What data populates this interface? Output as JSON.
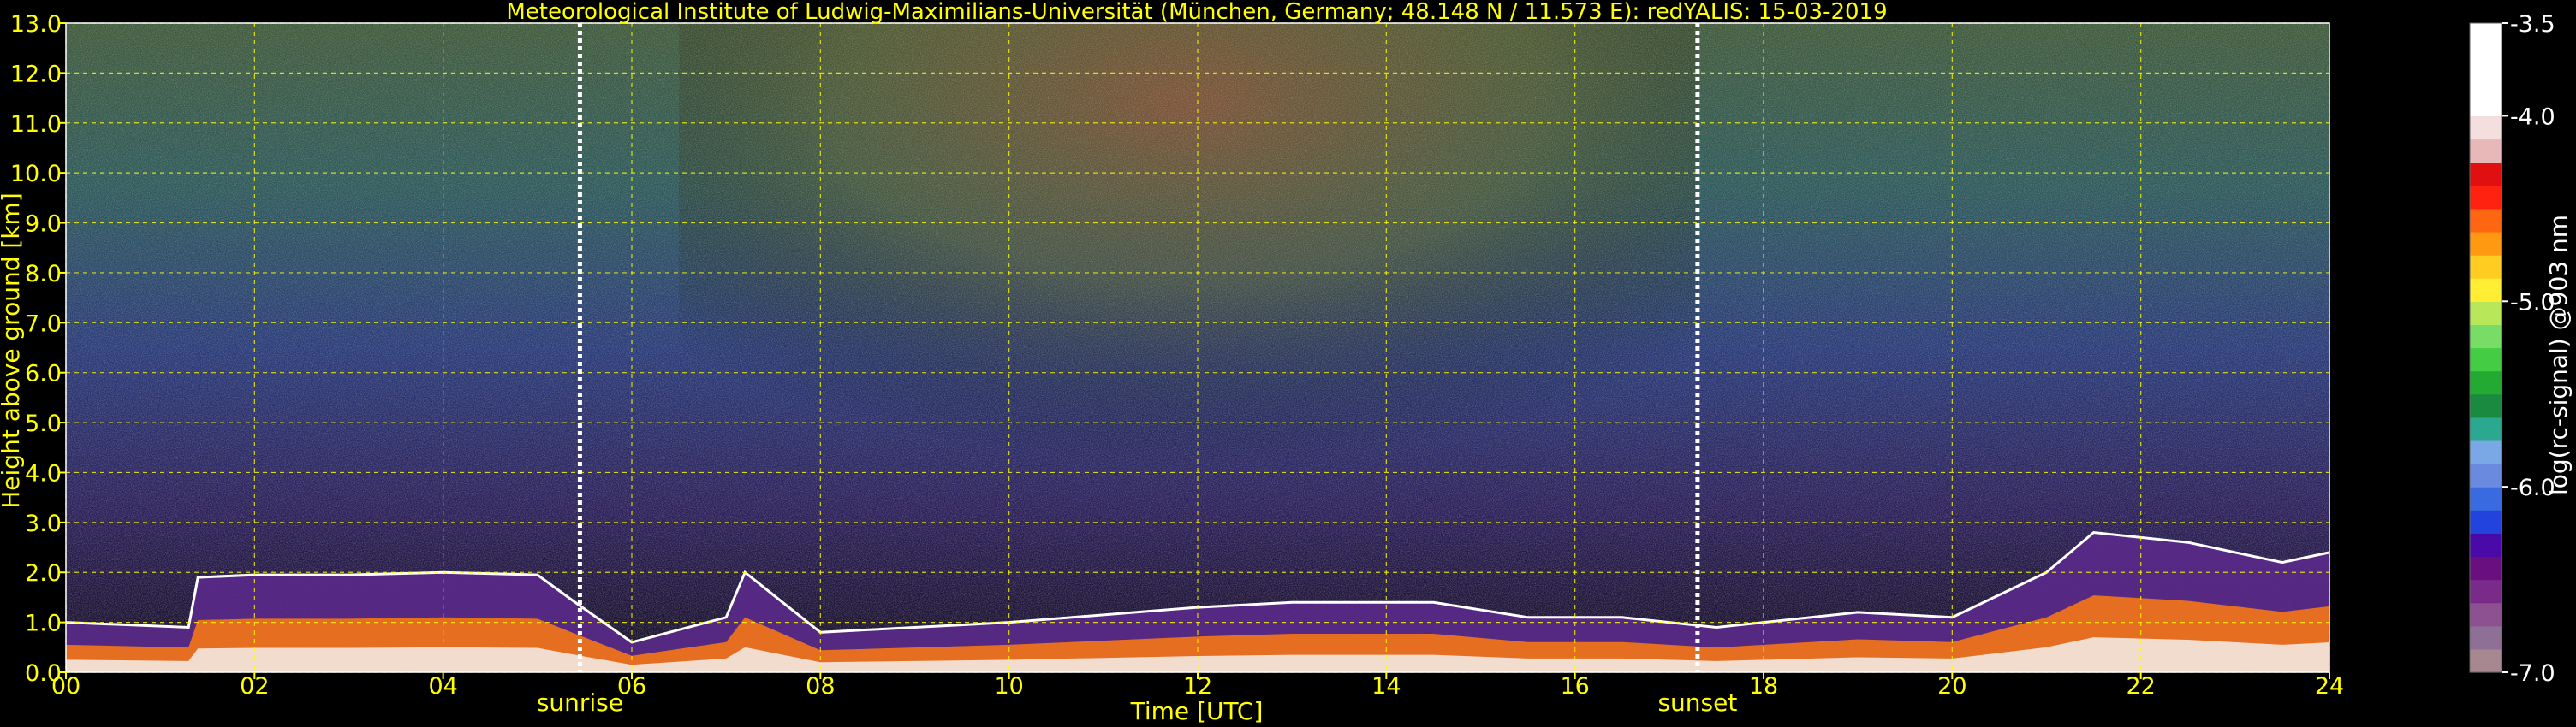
{
  "chart_data": {
    "type": "heatmap",
    "title": "Meteorological Institute of Ludwig-Maximilians-Universität (München, Germany; 48.148 N / 11.573 E):    redYALIS: 15-03-2019",
    "xlabel": "Time [UTC]",
    "ylabel": "Height above ground [km]",
    "xlim": [
      0,
      24
    ],
    "ylim": [
      0,
      13
    ],
    "x_ticks": [
      "00",
      "02",
      "04",
      "06",
      "08",
      "10",
      "12",
      "14",
      "16",
      "18",
      "20",
      "22",
      "24"
    ],
    "x_tick_values": [
      0,
      2,
      4,
      6,
      8,
      10,
      12,
      14,
      16,
      18,
      20,
      22,
      24
    ],
    "y_ticks": [
      "0.0",
      "1.0",
      "2.0",
      "3.0",
      "4.0",
      "5.0",
      "6.0",
      "7.0",
      "8.0",
      "9.0",
      "10.0",
      "11.0",
      "12.0",
      "13.0"
    ],
    "y_tick_values": [
      0,
      1,
      2,
      3,
      4,
      5,
      6,
      7,
      8,
      9,
      10,
      11,
      12,
      13
    ],
    "grid": true,
    "annotations": [
      {
        "label": "sunrise",
        "x": 5.45
      },
      {
        "label": "sunset",
        "x": 17.3
      }
    ],
    "boundary_layer_top_km": [
      [
        0,
        1.0
      ],
      [
        1.3,
        0.9
      ],
      [
        1.4,
        1.9
      ],
      [
        2.0,
        1.95
      ],
      [
        3.0,
        1.95
      ],
      [
        4.0,
        2.0
      ],
      [
        5.0,
        1.95
      ],
      [
        5.4,
        1.4
      ],
      [
        6.0,
        0.6
      ],
      [
        7.0,
        1.1
      ],
      [
        7.2,
        2.0
      ],
      [
        8.0,
        0.8
      ],
      [
        10.0,
        1.0
      ],
      [
        12.0,
        1.3
      ],
      [
        13.0,
        1.4
      ],
      [
        14.5,
        1.4
      ],
      [
        15.5,
        1.1
      ],
      [
        16.5,
        1.1
      ],
      [
        17.5,
        0.9
      ],
      [
        19.0,
        1.2
      ],
      [
        20.0,
        1.1
      ],
      [
        21.0,
        2.0
      ],
      [
        21.5,
        2.8
      ],
      [
        22.5,
        2.6
      ],
      [
        23.5,
        2.2
      ],
      [
        24,
        2.4
      ]
    ],
    "colorbar": {
      "label": "log(rc-signal) @903 nm",
      "range": [
        -7.0,
        -3.5
      ],
      "ticks": [
        "-3.5",
        "-4.0",
        "-5.0",
        "-6.0",
        "-7.0"
      ],
      "tick_values": [
        -3.5,
        -4.0,
        -5.0,
        -6.0,
        -7.0
      ],
      "colors": [
        "#a88890",
        "#8e6f95",
        "#8d5090",
        "#7a2a88",
        "#6a0f80",
        "#4a0aa8",
        "#2244dd",
        "#3a6ae0",
        "#6a8ae0",
        "#7aa8e6",
        "#2aa890",
        "#1a8a40",
        "#22aa33",
        "#44cc44",
        "#77dd66",
        "#b8e85a",
        "#ffee33",
        "#ffcc22",
        "#ff9911",
        "#ff6611",
        "#ff2211",
        "#e01010",
        "#e8b8b8",
        "#f5dede",
        "#ffffff",
        "#ffffff",
        "#ffffff",
        "#ffffff"
      ]
    }
  },
  "colors": {
    "text_axis": "#ffff00",
    "text_colorbar": "#ffffff",
    "grid": "#ffff00",
    "background": "#000000",
    "marker_line": "#ffffff"
  }
}
